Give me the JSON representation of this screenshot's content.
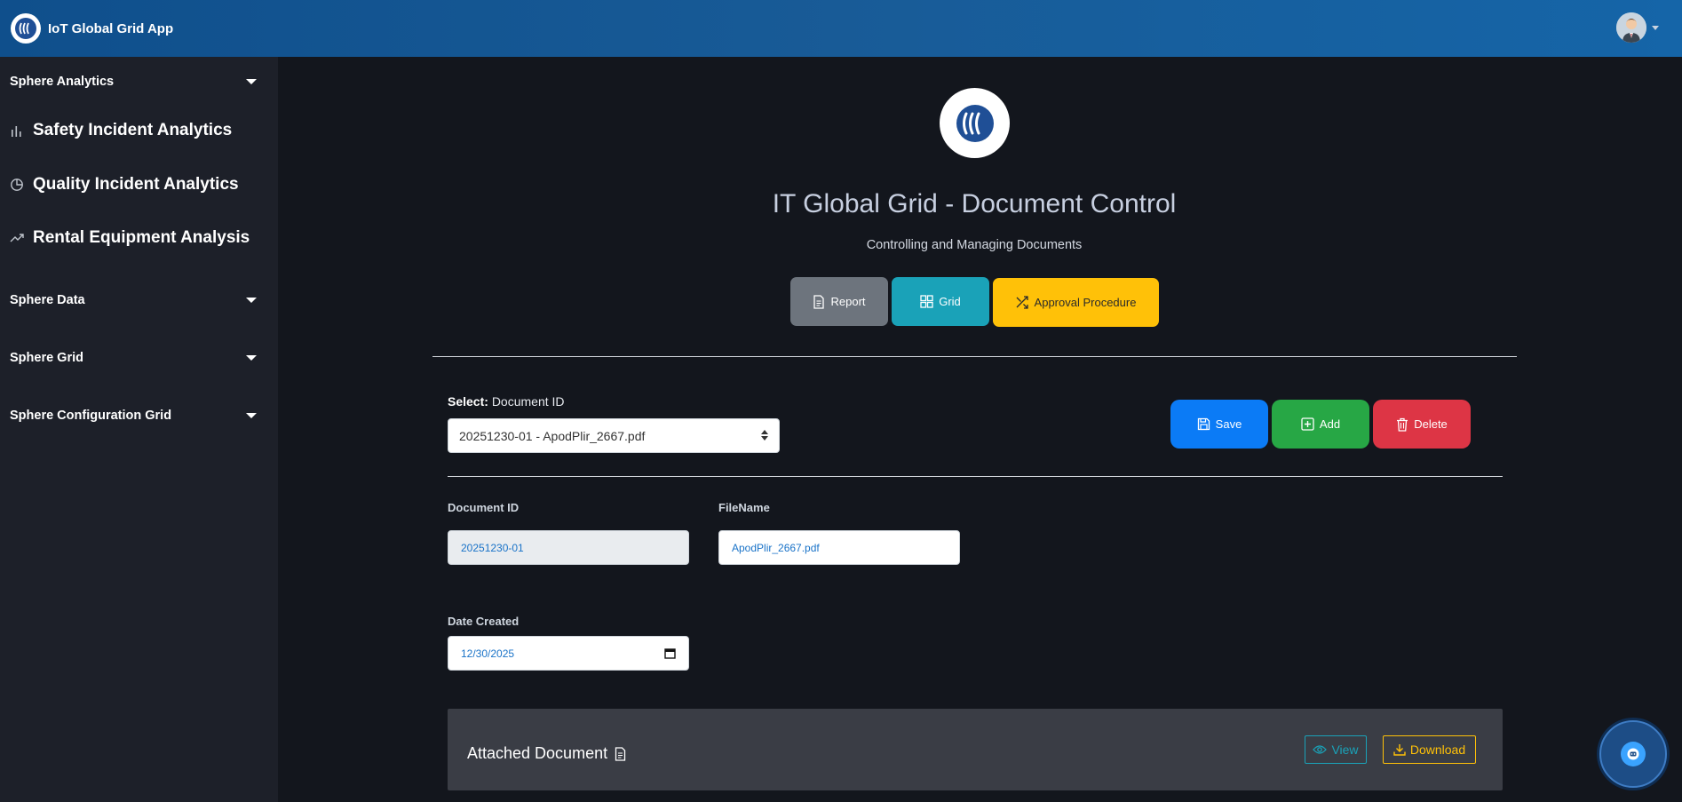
{
  "app": {
    "title": "IoT Global Grid App",
    "logo_icon": "grid-logo-icon"
  },
  "user": {
    "avatar_icon": "user-avatar-icon",
    "menu_icon": "chevron-down-icon"
  },
  "sidebar": {
    "sections": [
      {
        "label": "Sphere Analytics",
        "expanded": true
      },
      {
        "label": "Sphere Data",
        "expanded": false
      },
      {
        "label": "Sphere Grid",
        "expanded": false
      },
      {
        "label": "Sphere Configuration Grid",
        "expanded": false
      }
    ],
    "analytics_items": [
      {
        "label": "Safety Incident Analytics",
        "icon": "bar-chart-icon"
      },
      {
        "label": "Quality Incident Analytics",
        "icon": "pie-chart-icon"
      },
      {
        "label": "Rental Equipment Analysis",
        "icon": "trend-up-icon"
      }
    ]
  },
  "main": {
    "title": "IT Global Grid - Document Control",
    "subtitle": "Controlling and Managing Documents",
    "nav_buttons": {
      "report": "Report",
      "grid": "Grid",
      "approval": "Approval Procedure"
    },
    "select": {
      "label_bold": "Select:",
      "label": "Document ID",
      "value": "20251230-01 - ApodPlir_2667.pdf"
    },
    "actions": {
      "save": "Save",
      "add": "Add",
      "delete": "Delete"
    },
    "fields": {
      "document_id_label": "Document ID",
      "document_id_value": "20251230-01",
      "filename_label": "FileName",
      "filename_value": "ApodPlir_2667.pdf",
      "date_label": "Date Created",
      "date_value": "12/30/2025"
    },
    "attached": {
      "title": "Attached Document",
      "view": "View",
      "download": "Download"
    }
  },
  "colors": {
    "topbar": "#185b97",
    "sidebar": "#1d2029",
    "background": "#13161d",
    "report": "#6d747d",
    "grid": "#1aa2b8",
    "approval": "#ffc108",
    "save": "#0b7bf6",
    "add": "#27a745",
    "delete": "#dd3545"
  }
}
